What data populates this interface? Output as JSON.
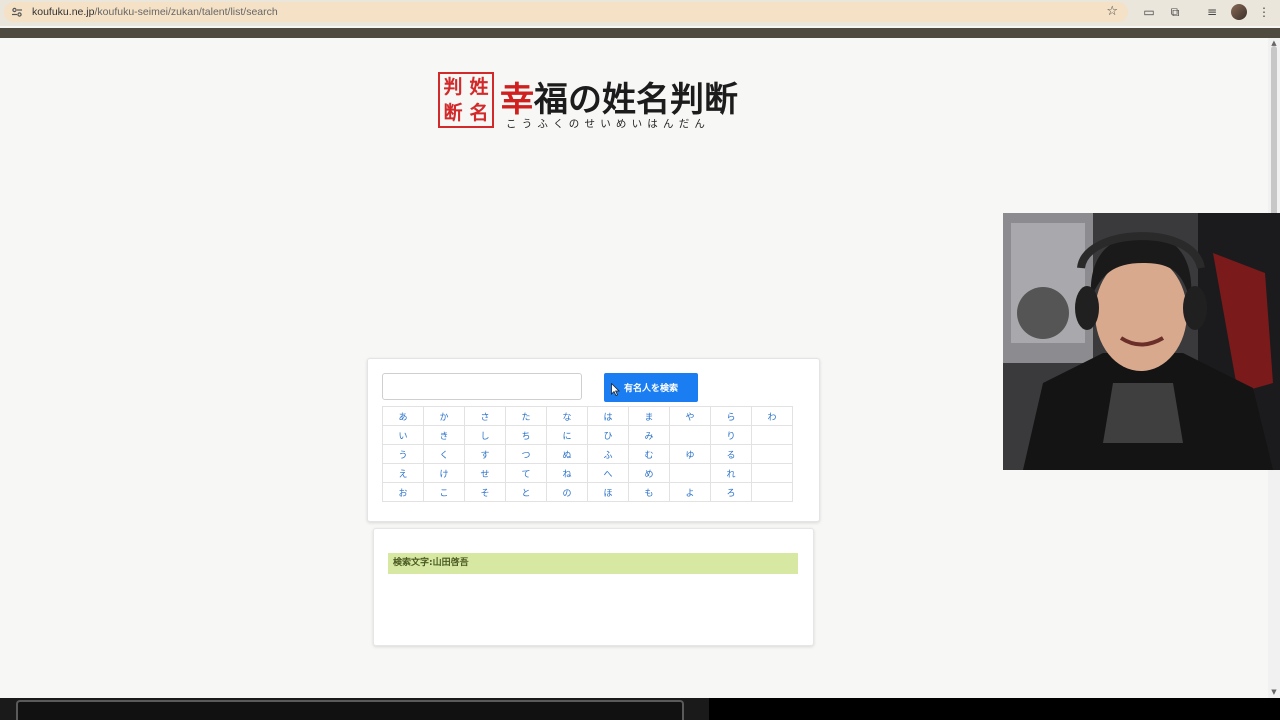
{
  "browser": {
    "url_host": "koufuku.ne.jp",
    "url_path": "/koufuku-seimei/zukan/talent/list/search"
  },
  "logo": {
    "seal_chars": [
      "姓",
      "名",
      "判",
      "断"
    ],
    "title_accent": "幸",
    "title_rest": "福の姓名判断",
    "subtitle": "こうふくのせいめいはんだん",
    "accent_color": "#d01f1f"
  },
  "search": {
    "input_value": "",
    "button_label": "有名人を検索",
    "button_color": "#1a7ef2"
  },
  "kana_rows": [
    [
      "あ",
      "か",
      "さ",
      "た",
      "な",
      "は",
      "ま",
      "や",
      "ら",
      "わ"
    ],
    [
      "い",
      "き",
      "し",
      "ち",
      "に",
      "ひ",
      "み",
      "",
      "り",
      ""
    ],
    [
      "う",
      "く",
      "す",
      "つ",
      "ぬ",
      "ふ",
      "む",
      "ゆ",
      "る",
      ""
    ],
    [
      "え",
      "け",
      "せ",
      "て",
      "ね",
      "へ",
      "め",
      "",
      "れ",
      ""
    ],
    [
      "お",
      "こ",
      "そ",
      "と",
      "の",
      "ほ",
      "も",
      "よ",
      "ろ",
      ""
    ]
  ],
  "result": {
    "banner_text": "検索文字:山田啓吾",
    "banner_color": "#d6e8a1"
  }
}
